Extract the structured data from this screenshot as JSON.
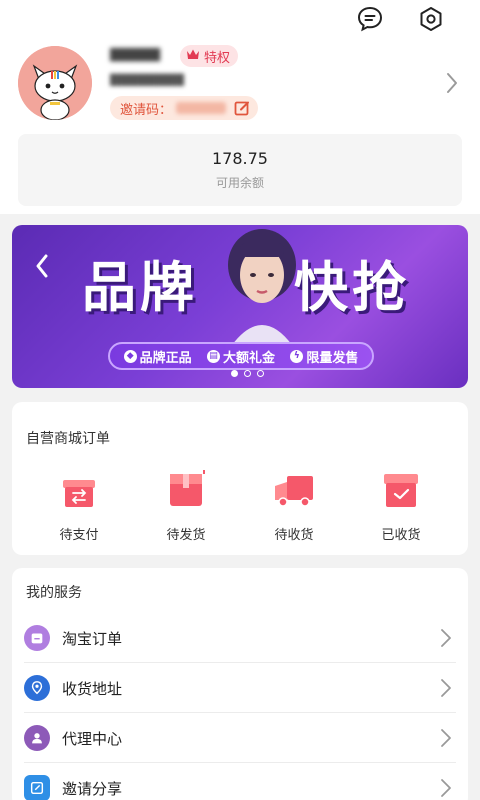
{
  "header": {
    "message_icon": "chat-bubble-icon",
    "settings_icon": "hexagon-gear-icon"
  },
  "profile": {
    "avatar": "cat-avatar",
    "vip_label": "特权",
    "invite_label": "邀请码："
  },
  "balance": {
    "value": "178.75",
    "label": "可用余额"
  },
  "banner": {
    "title_part1": "品牌",
    "title_part2": "快抢",
    "features": [
      "品牌正品",
      "大额礼金",
      "限量发售"
    ],
    "active_dot": 0,
    "dot_count": 3
  },
  "orders": {
    "title": "自营商城订单",
    "items": [
      {
        "label": "待支付",
        "icon": "gift-box-exchange-icon"
      },
      {
        "label": "待发货",
        "icon": "package-box-icon"
      },
      {
        "label": "待收货",
        "icon": "delivery-truck-icon"
      },
      {
        "label": "已收货",
        "icon": "box-check-icon"
      }
    ]
  },
  "services": {
    "title": "我的服务",
    "items": [
      {
        "label": "淘宝订单",
        "icon": "taobao-icon",
        "color": "#a26bd9"
      },
      {
        "label": "收货地址",
        "icon": "location-pin-icon",
        "color": "#2d6fd8"
      },
      {
        "label": "代理中心",
        "icon": "person-icon",
        "color": "#8d5ab8"
      },
      {
        "label": "邀请分享",
        "icon": "share-icon",
        "color": "#2f8fe6"
      }
    ]
  },
  "colors": {
    "accent_red": "#f05a6a",
    "vip_pink": "#e23a52",
    "banner_purple": "#7b3fd6"
  }
}
